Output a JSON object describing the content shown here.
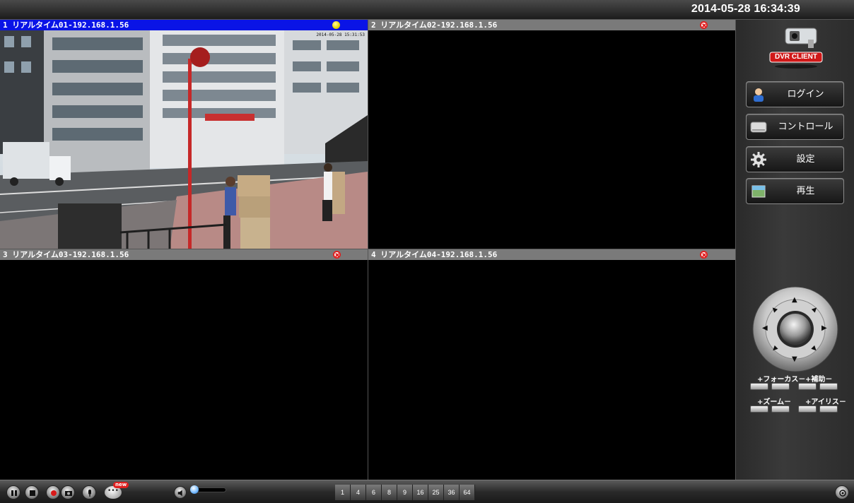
{
  "header": {
    "datetime": "2014-05-28 16:34:39"
  },
  "channels": [
    {
      "label": "1 リアルタイム01-192.168.1.56",
      "status": "ok",
      "active": true
    },
    {
      "label": "2 リアルタイム02-192.168.1.56",
      "status": "error",
      "active": false
    },
    {
      "label": "3 リアルタイム03-192.168.1.56",
      "status": "error",
      "active": false
    },
    {
      "label": "4 リアルタイム04-192.168.1.56",
      "status": "error",
      "active": false
    }
  ],
  "camera_overlay": {
    "timestamp": "2014-05-28 15:31:53"
  },
  "logo": {
    "text": "DVR CLIENT"
  },
  "sidebar": {
    "login": "ログイン",
    "control": "コントロール",
    "settings": "設定",
    "playback": "再生"
  },
  "ptz": {
    "focus": "+フォーカス－",
    "aux": "+補助－",
    "zoom": "+ズーム－",
    "iris": "+アイリス－"
  },
  "toolbar": {
    "new_badge": "new",
    "volume_level": 0.05,
    "splits": [
      "1",
      "4",
      "6",
      "8",
      "9",
      "16",
      "25",
      "36",
      "64"
    ]
  },
  "colors": {
    "active_header": "#0a14e6",
    "inactive_header": "#7a7a7a",
    "error_icon": "#e02020",
    "ok_icon": "#e6d400"
  }
}
